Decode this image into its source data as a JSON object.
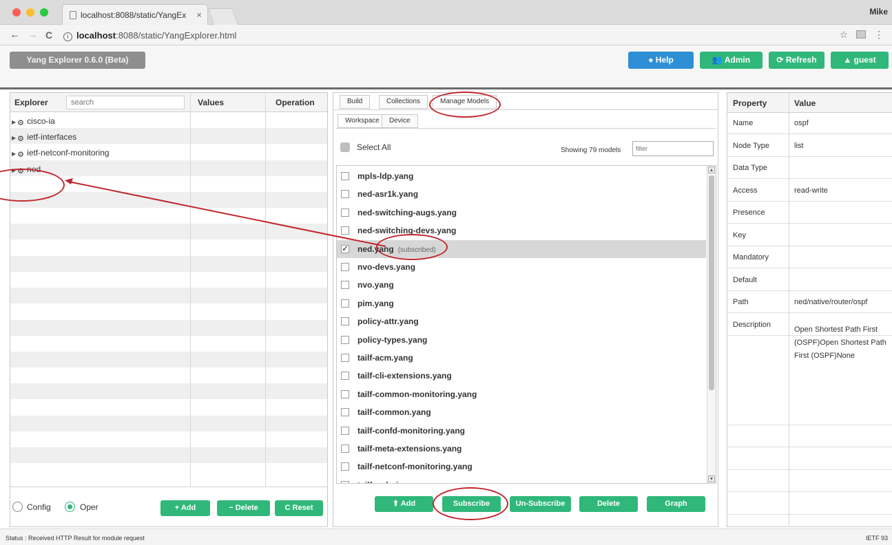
{
  "browser": {
    "tab_title": "localhost:8088/static/YangEx",
    "tab_close": "×",
    "user_name": "Mike",
    "url_host": "localhost",
    "url_rest": ":8088/static/YangExplorer.html",
    "nav_back": "←",
    "nav_forward": "→",
    "nav_reload": "C",
    "info_icon": "i",
    "star_icon": "☆",
    "menu_icon": "⋮"
  },
  "header": {
    "brand": "Yang Explorer 0.6.0 (Beta)",
    "help": "Help",
    "admin": "Admin",
    "refresh": "Refresh",
    "guest": "guest"
  },
  "explorer": {
    "columns": [
      "Explorer",
      "Values",
      "Operation"
    ],
    "search_placeholder": "search",
    "items": [
      {
        "label": "cisco-ia"
      },
      {
        "label": "ietf-interfaces"
      },
      {
        "label": "ietf-netconf-monitoring"
      },
      {
        "label": "ned"
      }
    ],
    "radio_config": "Config",
    "radio_oper": "Oper",
    "add": "+ Add",
    "delete": "− Delete",
    "reset": "C Reset"
  },
  "middle": {
    "tabs": [
      "Build",
      "Collections",
      "Manage Models"
    ],
    "subtabs": [
      "Workspace",
      "Device"
    ],
    "select_all": "Select All",
    "showing": "Showing 79 models",
    "filter_placeholder": "filter",
    "models": [
      {
        "name": "mpls-ldp.yang",
        "checked": false
      },
      {
        "name": "ned-asr1k.yang",
        "checked": false
      },
      {
        "name": "ned-switching-augs.yang",
        "checked": false
      },
      {
        "name": "ned-switching-devs.yang",
        "checked": false
      },
      {
        "name": "ned.yang",
        "checked": true,
        "tag": "(subscribed)"
      },
      {
        "name": "nvo-devs.yang",
        "checked": false
      },
      {
        "name": "nvo.yang",
        "checked": false
      },
      {
        "name": "pim.yang",
        "checked": false
      },
      {
        "name": "policy-attr.yang",
        "checked": false
      },
      {
        "name": "policy-types.yang",
        "checked": false
      },
      {
        "name": "tailf-acm.yang",
        "checked": false
      },
      {
        "name": "tailf-cli-extensions.yang",
        "checked": false
      },
      {
        "name": "tailf-common-monitoring.yang",
        "checked": false
      },
      {
        "name": "tailf-common.yang",
        "checked": false
      },
      {
        "name": "tailf-confd-monitoring.yang",
        "checked": false
      },
      {
        "name": "tailf-meta-extensions.yang",
        "checked": false
      },
      {
        "name": "tailf-netconf-monitoring.yang",
        "checked": false
      },
      {
        "name": "tailf-webui.yang",
        "checked": false
      }
    ],
    "buttons": {
      "add": "Add",
      "subscribe": "Subscribe",
      "unsubscribe": "Un-Subscribe",
      "delete": "Delete",
      "graph": "Graph"
    }
  },
  "properties": {
    "header_property": "Property",
    "header_value": "Value",
    "rows": [
      {
        "key": "Name",
        "value": "ospf"
      },
      {
        "key": "Node Type",
        "value": "list"
      },
      {
        "key": "Data Type",
        "value": ""
      },
      {
        "key": "Access",
        "value": "read-write"
      },
      {
        "key": "Presence",
        "value": ""
      },
      {
        "key": "Key",
        "value": ""
      },
      {
        "key": "Mandatory",
        "value": ""
      },
      {
        "key": "Default",
        "value": ""
      },
      {
        "key": "Path",
        "value": "ned/native/router/ospf"
      },
      {
        "key": "Description",
        "value": ""
      }
    ],
    "description": "Open Shortest Path First (OSPF)Open Shortest Path First (OSPF)None"
  },
  "status": {
    "text": "Status : Received HTTP Result for module request",
    "right": "IETF 93"
  },
  "colors": {
    "accent_green": "#2fb87a",
    "help_blue": "#2e8fd6",
    "annotation_red": "#c0262c"
  }
}
